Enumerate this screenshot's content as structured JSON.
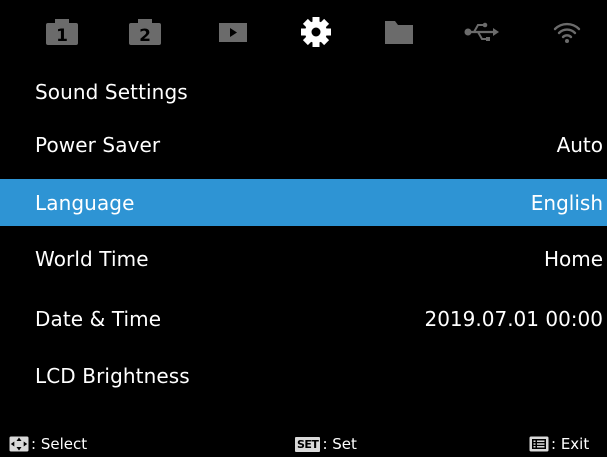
{
  "tabs": [
    {
      "name": "shooting-menu-1",
      "label": "1",
      "active": false
    },
    {
      "name": "shooting-menu-2",
      "label": "2",
      "active": false
    },
    {
      "name": "playback-menu",
      "label": "",
      "active": false
    },
    {
      "name": "settings-menu",
      "label": "",
      "active": true
    },
    {
      "name": "file-menu",
      "label": "",
      "active": false
    },
    {
      "name": "usb-menu",
      "label": "",
      "active": false
    },
    {
      "name": "wifi-menu",
      "label": "",
      "active": false
    }
  ],
  "menu": {
    "items": [
      {
        "label": "Sound Settings",
        "value": ""
      },
      {
        "label": "Power Saver",
        "value": "Auto"
      },
      {
        "label": "Language",
        "value": "English",
        "selected": true
      },
      {
        "label": "World Time",
        "value": "Home"
      },
      {
        "label": "Date & Time",
        "value": "2019.07.01 00:00"
      },
      {
        "label": "LCD Brightness",
        "value": ""
      }
    ]
  },
  "footer": {
    "select_label": ": Select",
    "set_key": "SET",
    "set_label": ": Set",
    "exit_label": ": Exit"
  },
  "colors": {
    "highlight": "#2e94d4",
    "tab_icon": "#6b6b6b",
    "background": "#000000"
  }
}
